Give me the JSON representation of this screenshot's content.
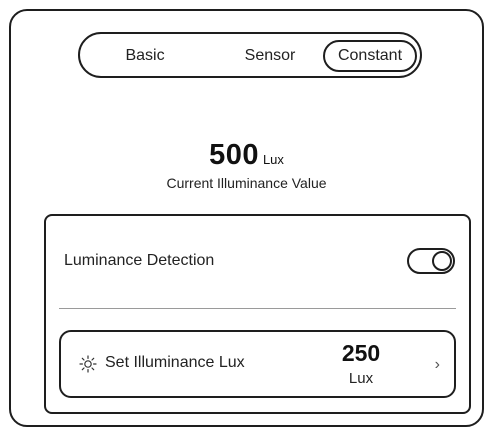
{
  "tabs": {
    "items": [
      {
        "label": "Basic"
      },
      {
        "label": "Sensor"
      },
      {
        "label": "Constant"
      }
    ],
    "active": "Constant"
  },
  "reading": {
    "value": "500",
    "unit": "Lux",
    "label": "Current Illuminance Value"
  },
  "detection": {
    "label": "Luminance Detection",
    "enabled": true
  },
  "set_illuminance": {
    "icon": "sun-icon",
    "label": "Set Illuminance Lux",
    "value": "250",
    "unit": "Lux",
    "chevron": "›"
  },
  "colors": {
    "stroke": "#1e1e1e",
    "background": "#ffffff",
    "divider": "#9a9a9a"
  }
}
